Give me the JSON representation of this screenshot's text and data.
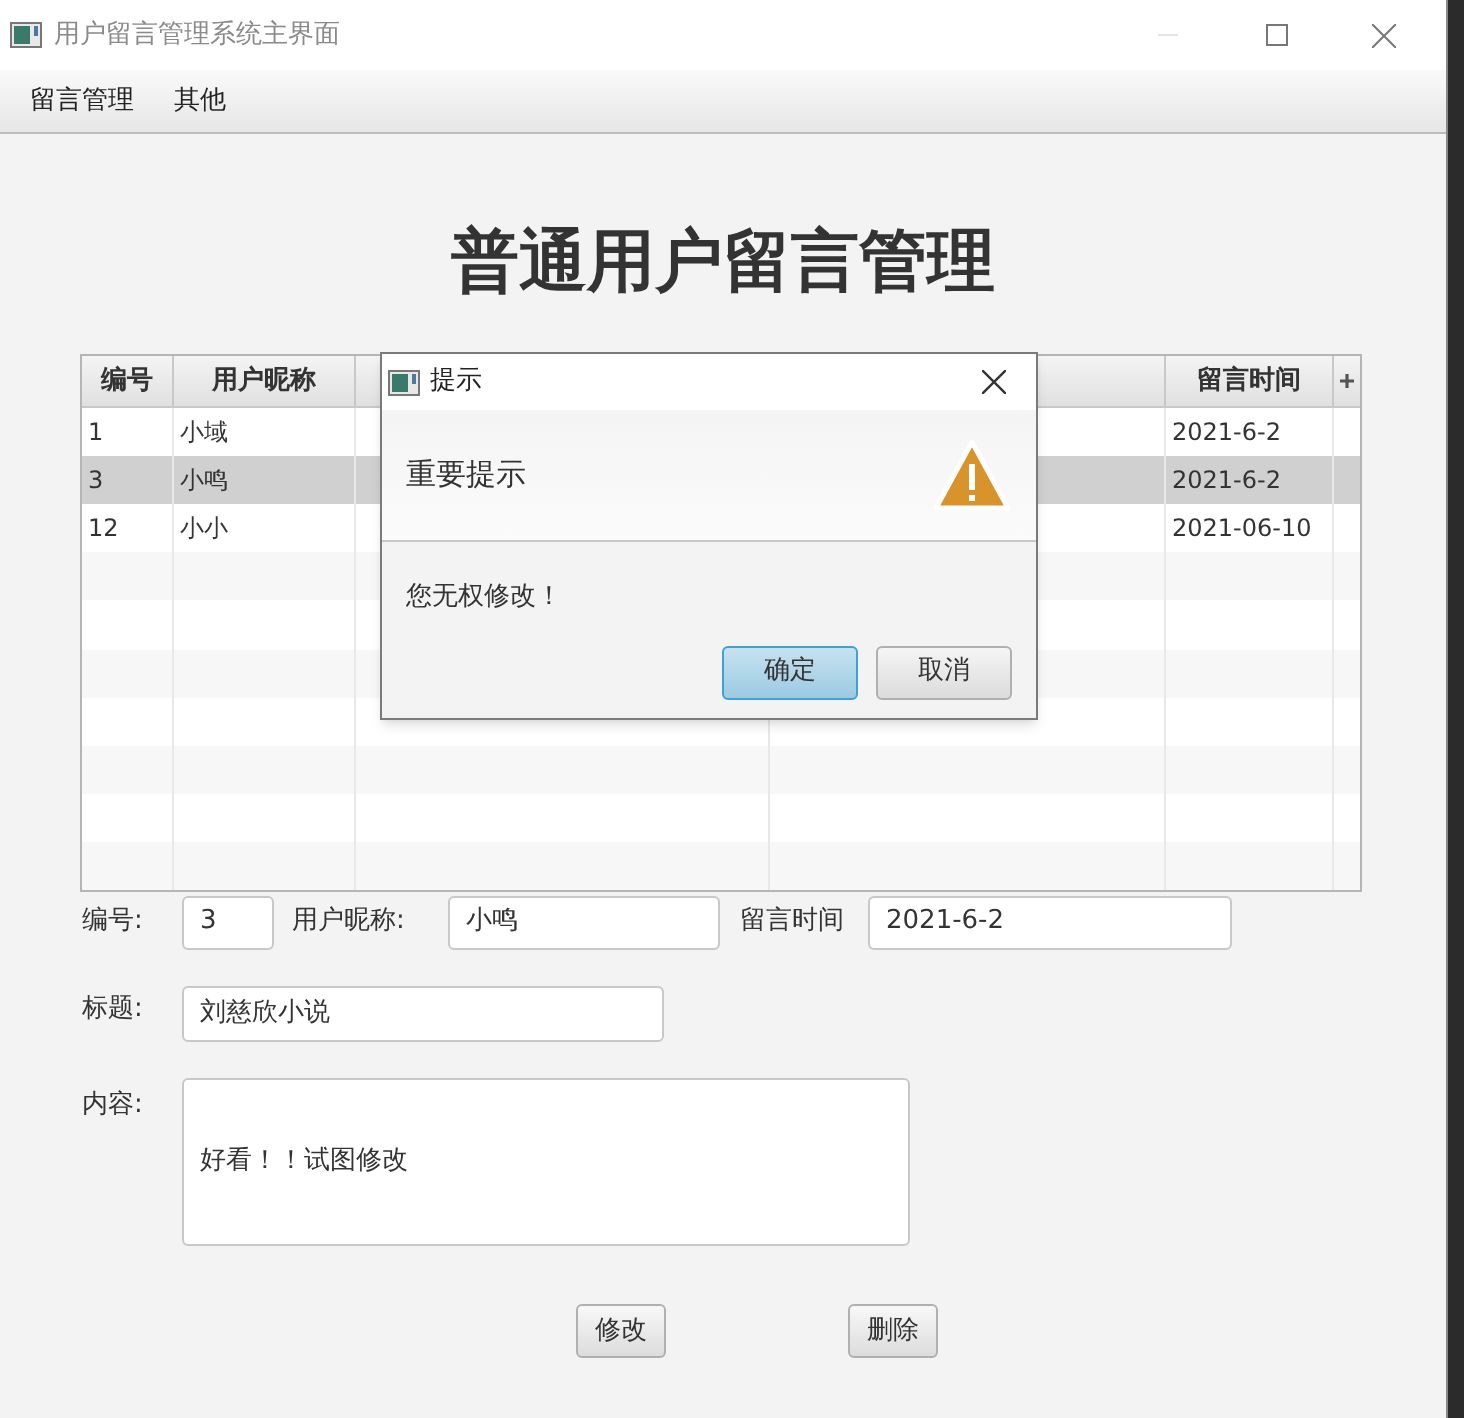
{
  "window": {
    "title": "用户留言管理系统主界面"
  },
  "menu": [
    "留言管理",
    "其他"
  ],
  "heading": "普通用户留言管理",
  "table": {
    "columns": [
      "编号",
      "用户昵称",
      null,
      null,
      "留言时间"
    ],
    "rows": [
      {
        "cells": [
          "1",
          "小域",
          null,
          null,
          "2021-6-2"
        ],
        "selected": false
      },
      {
        "cells": [
          "3",
          "小鸣",
          null,
          null,
          "2021-6-2"
        ],
        "selected": true
      },
      {
        "cells": [
          "12",
          "小小",
          null,
          null,
          "2021-06-10"
        ],
        "selected": false
      }
    ]
  },
  "form": {
    "id_label": "编号:",
    "id_value": "3",
    "nick_label": "用户昵称:",
    "nick_value": "小鸣",
    "time_label": "留言时间",
    "time_value": "2021-6-2",
    "title_label": "标题:",
    "title_value": "刘慈欣小说",
    "content_label": "内容:",
    "content_value": "好看！！试图修改"
  },
  "buttons": [
    "修改",
    "删除"
  ],
  "dialog": {
    "title": "提示",
    "header": "重要提示",
    "message": "您无权修改！",
    "buttons": [
      {
        "label": "确定",
        "default": true
      },
      {
        "label": "取消",
        "default": false
      }
    ]
  }
}
